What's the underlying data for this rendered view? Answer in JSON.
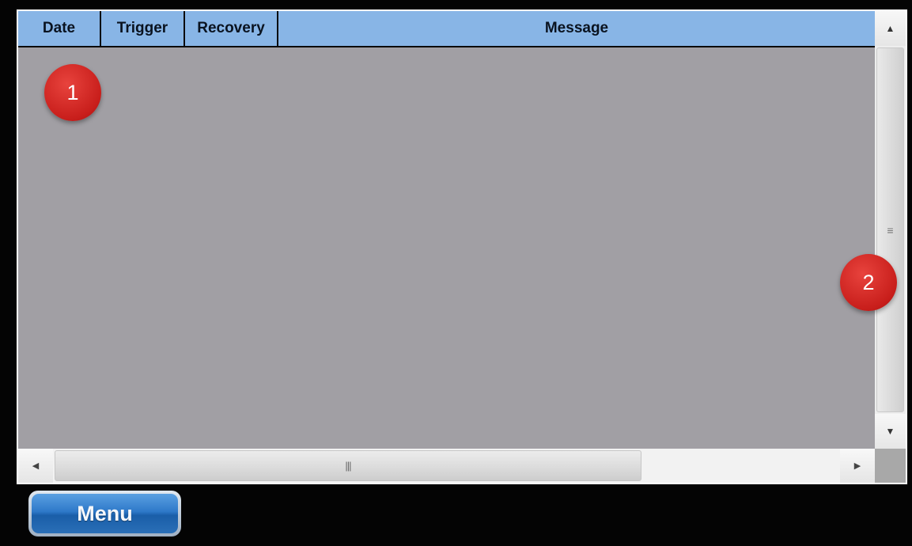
{
  "table": {
    "columns": [
      "Date",
      "Trigger",
      "Recovery",
      "Message"
    ],
    "rows": []
  },
  "annotations": [
    "1",
    "2"
  ],
  "scrollbars": {
    "vertical": {
      "up_icon": "arrow-up",
      "down_icon": "arrow-down",
      "grip_icon": "grip-lines-horizontal",
      "up_glyph": "▲",
      "down_glyph": "▼",
      "grip_glyph": "≡"
    },
    "horizontal": {
      "left_icon": "arrow-left",
      "right_icon": "arrow-right",
      "grip_icon": "grip-lines-vertical",
      "left_glyph": "◀",
      "right_glyph": "▶",
      "grip_glyph": "|||"
    }
  },
  "footer": {
    "menu_label": "Menu"
  },
  "colors": {
    "header_bg": "#88b5e6",
    "body_bg": "#a19fa4",
    "badge": "#d32420",
    "menu_button": "#2e79c9"
  }
}
